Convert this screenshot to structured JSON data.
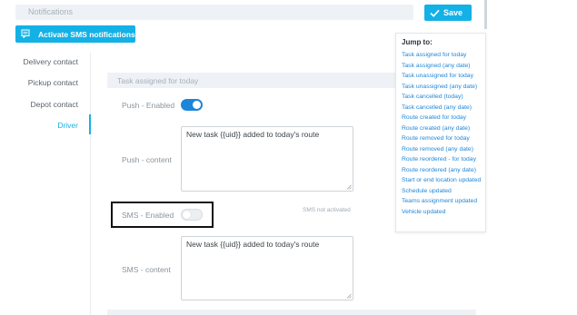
{
  "header": {
    "notifications_label": "Notifications",
    "save_label": "Save",
    "activate_sms_label": "Activate SMS notifications"
  },
  "sidebar": {
    "items": [
      {
        "label": "Delivery contact",
        "active": false
      },
      {
        "label": "Pickup contact",
        "active": false
      },
      {
        "label": "Depot contact",
        "active": false
      },
      {
        "label": "Driver",
        "active": true
      }
    ]
  },
  "section": {
    "title": "Task assigned for today",
    "push_enabled_label": "Push - Enabled",
    "push_enabled": true,
    "push_content_label": "Push - content",
    "push_content_value": "New task {{uid}} added to today's route",
    "sms_enabled_label": "SMS - Enabled",
    "sms_enabled": false,
    "sms_status_note": "SMS not activated",
    "sms_content_label": "SMS - content",
    "sms_content_value": "New task {{uid}} added to today's route"
  },
  "jump_to": {
    "title": "Jump to:",
    "items": [
      "Task assigned for today",
      "Task assigned (any date)",
      "Task unassigned for today",
      "Task unassigned (any date)",
      "Task cancelled (today)",
      "Task cancelled (any date)",
      "Route created for today",
      "Route created (any date)",
      "Route removed for today",
      "Route removed (any date)",
      "Route reordered - for today",
      "Route reordered (any date)",
      "Start or end location updated",
      "Schedule updated",
      "Teams assignment updated",
      "Vehicle updated"
    ]
  },
  "colors": {
    "accent": "#14b1e6",
    "toggle_on": "#1e86d8",
    "link": "#1e86d8"
  },
  "icons": {
    "save": "check-icon",
    "sms": "message-icon"
  }
}
